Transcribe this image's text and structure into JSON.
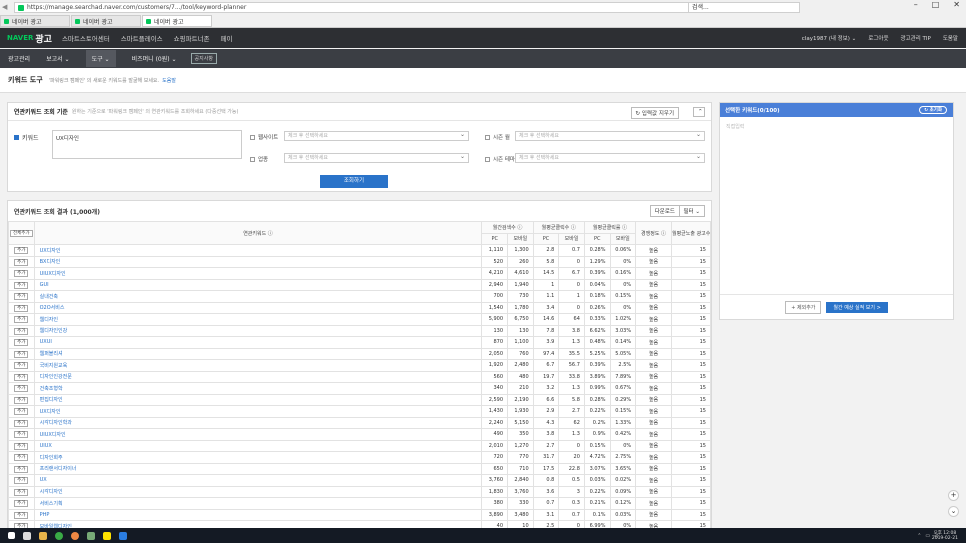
{
  "browser": {
    "url": "https://manage.searchad.naver.com/customers/7.../tool/keyword-planner",
    "search_placeholder": "검색...",
    "tabs": [
      {
        "label": "네이버 광고"
      },
      {
        "label": "네이버 광고"
      },
      {
        "label": "네이버 광고"
      }
    ]
  },
  "header": {
    "logo": "NAVER",
    "logo_sub": "광고",
    "nav": [
      "스마트스토어센터",
      "스마트플레이스",
      "쇼핑파트너존",
      "페이"
    ],
    "account": "clay1987 (내 정보) ⌄",
    "logout": "로그아웃",
    "center": "광고관리 TIP",
    "help": "도움말"
  },
  "subnav": {
    "items": [
      "광고관리",
      "보고서 ⌄",
      "도구 ⌄",
      "비즈머니 (0원) ⌄"
    ],
    "notice": "공지사항"
  },
  "page": {
    "title": "키워드 도구",
    "desc": "'파워링크 캠페인' 의 새로운 키워드를 발굴해 보세요.",
    "help": "도움말"
  },
  "condition": {
    "title": "연관키워드 조회 기준",
    "desc": "원하는 기준으로 '파워링크 캠페인' 의 연관키워드를 조회하세요 (다중선택 가능)",
    "close_label": "입력값 지우기",
    "keyword_label": "키워드",
    "keyword_value": "UX디자인",
    "website_label": "웹사이트",
    "website_placeholder": "체크 후 선택하세요",
    "season_month_label": "시즌 월",
    "season_month_placeholder": "체크 후 선택하세요",
    "industry_label": "업종",
    "industry_placeholder": "체크 후 선택하세요",
    "season_theme_label": "시즌 테마",
    "season_theme_placeholder": "체크 후 선택하세요",
    "search_label": "조회하기"
  },
  "results": {
    "title": "연관키워드 조회 결과 (1,000개)",
    "download": "다운로드",
    "filter": "필터 ⌄",
    "headers": {
      "add_all": "전체추가",
      "keyword": "연관키워드",
      "monthly_search": "월간검색수",
      "monthly_clicks": "월평균클릭수",
      "monthly_ctr": "월평균클릭률",
      "competition": "경쟁정도",
      "ad_depth": "월평균노출 광고수",
      "pc": "PC",
      "mobile": "모바일"
    },
    "add_label": "추가",
    "rows": [
      {
        "kw": "UX디자인",
        "pc": "1,110",
        "mo": "1,300",
        "cpc": "2.8",
        "cmo": "0.7",
        "rpc": "0.28%",
        "rmo": "0.06%",
        "comp": "높음",
        "depth": "15"
      },
      {
        "kw": "BX디자인",
        "pc": "520",
        "mo": "260",
        "cpc": "5.8",
        "cmo": "0",
        "rpc": "1.29%",
        "rmo": "0%",
        "comp": "높음",
        "depth": "15"
      },
      {
        "kw": "UIUX디자인",
        "pc": "4,210",
        "mo": "4,610",
        "cpc": "14.5",
        "cmo": "6.7",
        "rpc": "0.39%",
        "rmo": "0.16%",
        "comp": "높음",
        "depth": "15"
      },
      {
        "kw": "GUI",
        "pc": "2,940",
        "mo": "1,940",
        "cpc": "1",
        "cmo": "0",
        "rpc": "0.04%",
        "rmo": "0%",
        "comp": "높음",
        "depth": "15"
      },
      {
        "kw": "실내건축",
        "pc": "700",
        "mo": "730",
        "cpc": "1.1",
        "cmo": "1",
        "rpc": "0.18%",
        "rmo": "0.15%",
        "comp": "높음",
        "depth": "15"
      },
      {
        "kw": "O2O서비스",
        "pc": "1,540",
        "mo": "1,780",
        "cpc": "3.4",
        "cmo": "0",
        "rpc": "0.26%",
        "rmo": "0%",
        "comp": "높음",
        "depth": "15"
      },
      {
        "kw": "웹디자인",
        "pc": "5,900",
        "mo": "6,750",
        "cpc": "14.6",
        "cmo": "64",
        "rpc": "0.33%",
        "rmo": "1.02%",
        "comp": "높음",
        "depth": "15"
      },
      {
        "kw": "웹디자인인강",
        "pc": "130",
        "mo": "130",
        "cpc": "7.8",
        "cmo": "3.8",
        "rpc": "6.62%",
        "rmo": "3.03%",
        "comp": "높음",
        "depth": "15"
      },
      {
        "kw": "UXUI",
        "pc": "870",
        "mo": "1,100",
        "cpc": "3.9",
        "cmo": "1.3",
        "rpc": "0.48%",
        "rmo": "0.14%",
        "comp": "높음",
        "depth": "15"
      },
      {
        "kw": "웹퍼블리셔",
        "pc": "2,050",
        "mo": "760",
        "cpc": "97.4",
        "cmo": "35.5",
        "rpc": "5.25%",
        "rmo": "5.05%",
        "comp": "높음",
        "depth": "15"
      },
      {
        "kw": "국비지원교육",
        "pc": "1,920",
        "mo": "2,480",
        "cpc": "6.7",
        "cmo": "56.7",
        "rpc": "0.39%",
        "rmo": "2.5%",
        "comp": "높음",
        "depth": "15"
      },
      {
        "kw": "디자인인강전문",
        "pc": "560",
        "mo": "480",
        "cpc": "19.7",
        "cmo": "33.8",
        "rpc": "3.89%",
        "rmo": "7.89%",
        "comp": "높음",
        "depth": "15"
      },
      {
        "kw": "건축조형학",
        "pc": "340",
        "mo": "210",
        "cpc": "3.2",
        "cmo": "1.3",
        "rpc": "0.99%",
        "rmo": "0.67%",
        "comp": "높음",
        "depth": "15"
      },
      {
        "kw": "편집디자인",
        "pc": "2,590",
        "mo": "2,190",
        "cpc": "6.6",
        "cmo": "5.8",
        "rpc": "0.28%",
        "rmo": "0.29%",
        "comp": "높음",
        "depth": "15"
      },
      {
        "kw": "UX디자인",
        "pc": "1,430",
        "mo": "1,930",
        "cpc": "2.9",
        "cmo": "2.7",
        "rpc": "0.22%",
        "rmo": "0.15%",
        "comp": "높음",
        "depth": "15"
      },
      {
        "kw": "시각디자인학과",
        "pc": "2,240",
        "mo": "5,150",
        "cpc": "4.3",
        "cmo": "62",
        "rpc": "0.2%",
        "rmo": "1.33%",
        "comp": "높음",
        "depth": "15"
      },
      {
        "kw": "UIUX디자인",
        "pc": "490",
        "mo": "350",
        "cpc": "3.8",
        "cmo": "1.3",
        "rpc": "0.9%",
        "rmo": "0.42%",
        "comp": "높음",
        "depth": "15"
      },
      {
        "kw": "UIUX",
        "pc": "2,010",
        "mo": "1,270",
        "cpc": "2.7",
        "cmo": "0",
        "rpc": "0.15%",
        "rmo": "0%",
        "comp": "높음",
        "depth": "15"
      },
      {
        "kw": "디자인회주",
        "pc": "720",
        "mo": "770",
        "cpc": "31.7",
        "cmo": "20",
        "rpc": "4.72%",
        "rmo": "2.75%",
        "comp": "높음",
        "depth": "15"
      },
      {
        "kw": "프리랜서디자이너",
        "pc": "650",
        "mo": "710",
        "cpc": "17.5",
        "cmo": "22.8",
        "rpc": "3.07%",
        "rmo": "3.65%",
        "comp": "높음",
        "depth": "15"
      },
      {
        "kw": "UX",
        "pc": "3,760",
        "mo": "2,840",
        "cpc": "0.8",
        "cmo": "0.5",
        "rpc": "0.03%",
        "rmo": "0.02%",
        "comp": "높음",
        "depth": "15"
      },
      {
        "kw": "시각디자인",
        "pc": "1,830",
        "mo": "3,760",
        "cpc": "3.6",
        "cmo": "3",
        "rpc": "0.22%",
        "rmo": "0.09%",
        "comp": "높음",
        "depth": "15"
      },
      {
        "kw": "서비스기획",
        "pc": "380",
        "mo": "330",
        "cpc": "0.7",
        "cmo": "0.3",
        "rpc": "0.21%",
        "rmo": "0.12%",
        "comp": "높음",
        "depth": "15"
      },
      {
        "kw": "PHP",
        "pc": "3,890",
        "mo": "3,480",
        "cpc": "3.1",
        "cmo": "0.7",
        "rpc": "0.1%",
        "rmo": "0.03%",
        "comp": "높음",
        "depth": "15"
      },
      {
        "kw": "모바일웹디자인",
        "pc": "40",
        "mo": "10",
        "cpc": "2.5",
        "cmo": "0",
        "rpc": "6.99%",
        "rmo": "0%",
        "comp": "높음",
        "depth": "15"
      }
    ]
  },
  "selected": {
    "title": "선택한 키워드(0/100)",
    "reset": "초기화",
    "empty": "직접입력",
    "add_more": "+ 제외추가",
    "view": "월간 예상 실적 보기 >"
  },
  "taskbar": {
    "time": "오후 12:08",
    "date": "2019-02-21"
  },
  "colors": {
    "brand": "#03c75a",
    "accent": "#2a73c9",
    "header_bg": "#2d2f33"
  }
}
